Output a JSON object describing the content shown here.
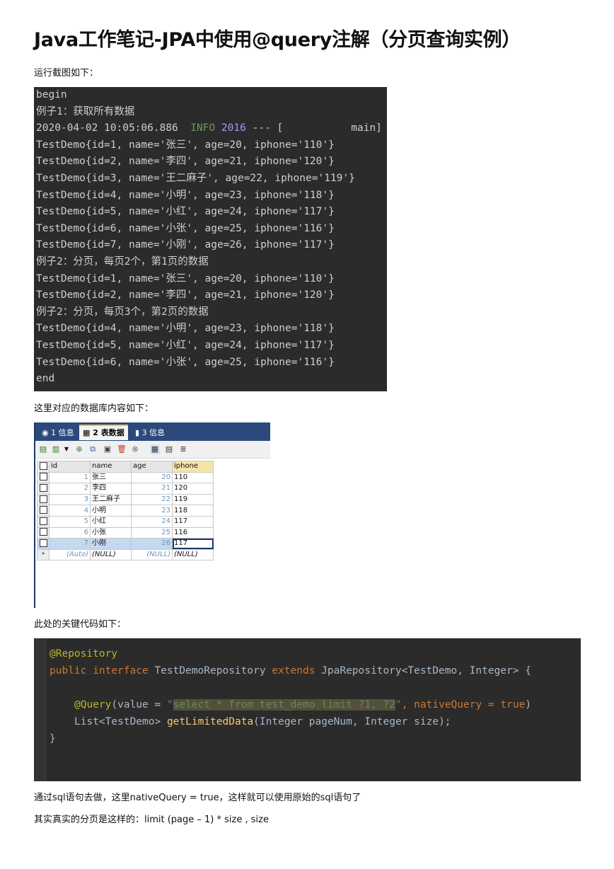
{
  "title": "Java工作笔记-JPA中使用@query注解（分页查询实例）",
  "p1": "运行截图如下：",
  "console": {
    "lines": [
      "begin",
      "例子1：获取所有数据",
      "",
      "TestDemo{id=1, name='张三', age=20, iphone='110'}",
      "TestDemo{id=2, name='李四', age=21, iphone='120'}",
      "TestDemo{id=3, name='王二麻子', age=22, iphone='119'}",
      "TestDemo{id=4, name='小明', age=23, iphone='118'}",
      "TestDemo{id=5, name='小红', age=24, iphone='117'}",
      "TestDemo{id=6, name='小张', age=25, iphone='116'}",
      "TestDemo{id=7, name='小刚', age=26, iphone='117'}",
      "例子2：分页，每页2个，第1页的数据",
      "TestDemo{id=1, name='张三', age=20, iphone='110'}",
      "TestDemo{id=2, name='李四', age=21, iphone='120'}",
      "例子2：分页，每页3个，第2页的数据",
      "TestDemo{id=4, name='小明', age=23, iphone='118'}",
      "TestDemo{id=5, name='小红', age=24, iphone='117'}",
      "TestDemo{id=6, name='小张', age=25, iphone='116'}",
      "end"
    ],
    "log_ts": "2020-04-02 10:05:06.886",
    "log_level": "INFO",
    "log_pid": "2016",
    "log_rest": " --- [           main]"
  },
  "p2": "这里对应的数据库内容如下：",
  "db": {
    "tabs": [
      "1 信息",
      "2 表数据",
      "3 信息"
    ],
    "columns": [
      "id",
      "name",
      "age",
      "iphone"
    ],
    "rows": [
      [
        "1",
        "张三",
        "20",
        "110"
      ],
      [
        "2",
        "李四",
        "21",
        "120"
      ],
      [
        "3",
        "王二麻子",
        "22",
        "119"
      ],
      [
        "4",
        "小明",
        "23",
        "118"
      ],
      [
        "5",
        "小红",
        "24",
        "117"
      ],
      [
        "6",
        "小张",
        "25",
        "116"
      ],
      [
        "7",
        "小刚",
        "26",
        "117"
      ]
    ],
    "new_row": [
      "(Auto)",
      "(NULL)",
      "(NULL)",
      "(NULL)"
    ],
    "selected_row": 6
  },
  "p3": "此处的关键代码如下：",
  "code": {
    "l1": "@Repository",
    "l2_kw1": "public",
    "l2_kw2": "interface",
    "l2_name": "TestDemoRepository",
    "l2_kw3": "extends",
    "l2_rest": "JpaRepository<TestDemo, Integer> {",
    "l3_ann": "@Query",
    "l3_a": "(value = ",
    "l3_q": "\"",
    "l3_sql": "select * from test_demo limit ?1, ?2",
    "l3_q2": "\"",
    "l3_b": ", nativeQuery = ",
    "l3_true": "true",
    "l3_c": ")",
    "l4_a": "List<TestDemo> ",
    "l4_fn": "getLimitedData",
    "l4_b": "(Integer pageNum, Integer size);",
    "l5": "}"
  },
  "p4": "通过sql语句去做，这里nativeQuery = true，这样就可以使用原始的sql语句了",
  "p5": "其实真实的分页是这样的：limit (page – 1) * size , size"
}
